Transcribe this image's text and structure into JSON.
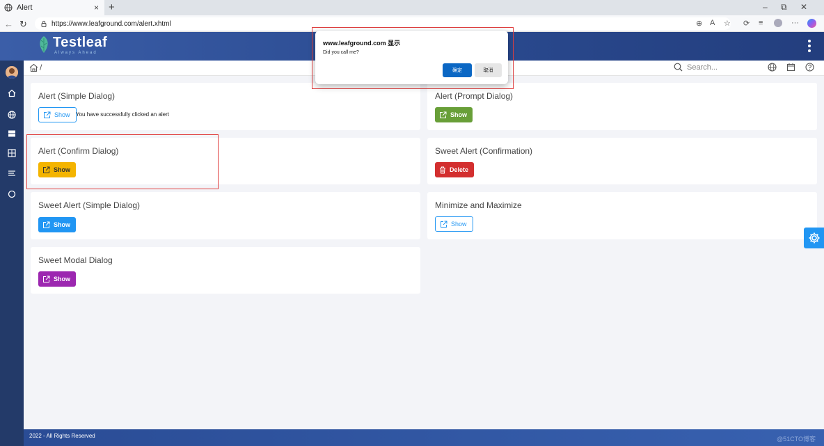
{
  "browser": {
    "tab_title": "Alert",
    "url": "https://www.leafground.com/alert.xhtml",
    "new_tab_symbol": "+",
    "tab_close_symbol": "×"
  },
  "header": {
    "brand_name": "Testleaf",
    "brand_tagline": "Always Ahead"
  },
  "breadcrumb": {
    "separator": "/"
  },
  "search": {
    "placeholder": "Search..."
  },
  "cards": {
    "simple_dialog": {
      "title": "Alert (Simple Dialog)",
      "button": "Show",
      "result": "You have successfully clicked an alert"
    },
    "prompt_dialog": {
      "title": "Alert (Prompt Dialog)",
      "button": "Show"
    },
    "confirm_dialog": {
      "title": "Alert (Confirm Dialog)",
      "button": "Show"
    },
    "sweet_confirmation": {
      "title": "Sweet Alert (Confirmation)",
      "button": "Delete"
    },
    "sweet_simple": {
      "title": "Sweet Alert (Simple Dialog)",
      "button": "Show"
    },
    "minmax": {
      "title": "Minimize and Maximize",
      "button": "Show"
    },
    "sweet_modal": {
      "title": "Sweet Modal Dialog",
      "button": "Show"
    }
  },
  "dialog": {
    "title": "www.leafground.com 显示",
    "message": "Did you call me?",
    "ok": "确定",
    "cancel": "取消"
  },
  "footer": {
    "copyright": "2022 - All Rights Reserved",
    "watermark": "@51CTO博客"
  },
  "colors": {
    "header_blue": "#2b4b91",
    "sidebar": "#233a69",
    "primary": "#2196f3",
    "success": "#689f38",
    "warning": "#f4b400",
    "danger": "#d32f2f",
    "help": "#9c27b0"
  },
  "icons": [
    "globe-icon",
    "back-icon",
    "reload-icon",
    "lock-icon",
    "home-icon",
    "search-icon",
    "calendar-icon",
    "help-icon",
    "external-link-icon",
    "trash-icon",
    "gear-icon",
    "kebab-icon"
  ]
}
